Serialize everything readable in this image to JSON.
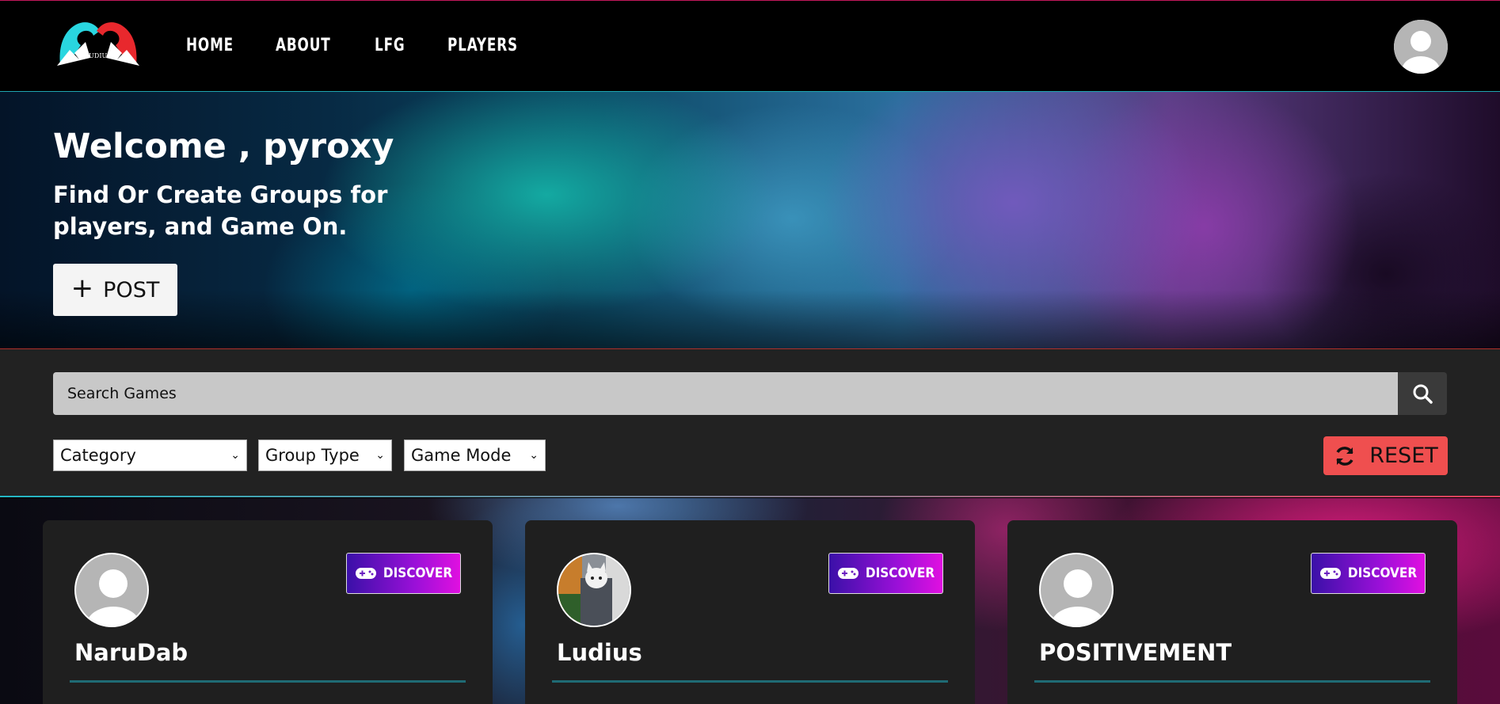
{
  "nav": {
    "logo_text": "LUDIUS",
    "links": [
      {
        "label": "HOME"
      },
      {
        "label": "ABOUT"
      },
      {
        "label": "LFG"
      },
      {
        "label": "PLAYERS"
      }
    ]
  },
  "hero": {
    "welcome": "Welcome , pyroxy",
    "tagline": "Find Or Create Groups for players, and Game On.",
    "post_button": "POST"
  },
  "filters": {
    "search_placeholder": "Search Games",
    "category": "Category",
    "group_type": "Group Type",
    "game_mode": "Game Mode",
    "reset_button": "RESET"
  },
  "cards": [
    {
      "name": "NaruDab",
      "discover": "DISCOVER",
      "avatar": "default-avatar"
    },
    {
      "name": "Ludius",
      "discover": "DISCOVER",
      "avatar": "cat-photo"
    },
    {
      "name": "POSITIVEMENT",
      "discover": "DISCOVER",
      "avatar": "default-avatar"
    }
  ],
  "colors": {
    "reset": "#ef4f4f",
    "discover_gradient_start": "#3a10a8",
    "discover_gradient_end": "#e010e0",
    "card_bg": "#1f1f1f",
    "filter_bg": "#222222"
  }
}
